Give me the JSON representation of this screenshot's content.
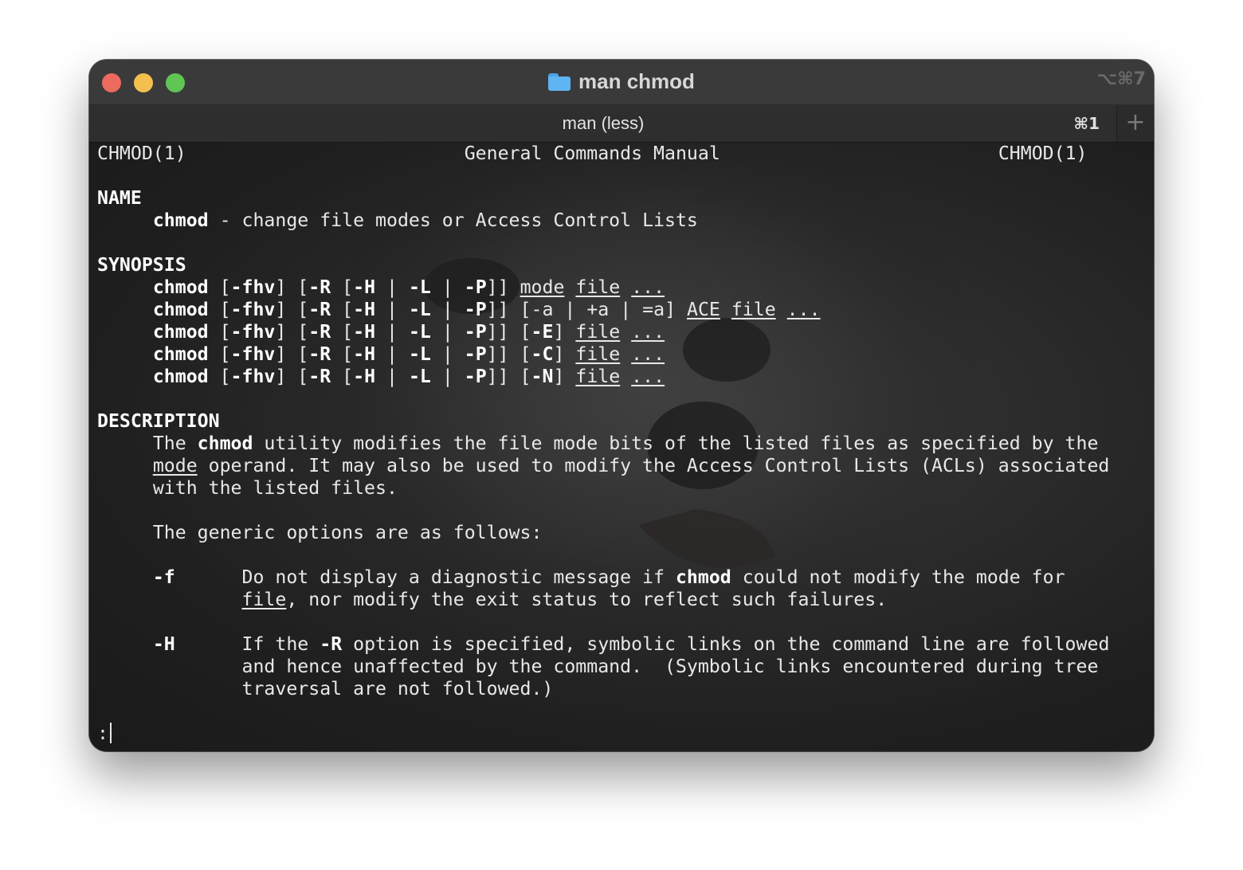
{
  "window": {
    "title": "man chmod",
    "title_shortcut": "⌥⌘7"
  },
  "tab": {
    "label": "man (less)",
    "shortcut": "⌘1",
    "new_tab_glyph": "+"
  },
  "man": {
    "header_left": "CHMOD(1)",
    "header_center": "General Commands Manual",
    "header_right": "CHMOD(1)",
    "name_heading": "NAME",
    "name_cmd": "chmod",
    "name_desc": " - change file modes or Access Control Lists",
    "synopsis_heading": "SYNOPSIS",
    "description_heading": "DESCRIPTION",
    "desc_p1_a": "The ",
    "desc_p1_cmd": "chmod",
    "desc_p1_b": " utility modifies the file mode bits of the listed files as specified by the",
    "desc_p1_mode": "mode",
    "desc_p1_c": " operand. It may also be used to modify the Access Control Lists (ACLs) associated",
    "desc_p1_d": "with the listed files.",
    "desc_p2": "The generic options are as follows:",
    "opt_f_flag": "-f",
    "opt_f_a": "Do not display a diagnostic message if ",
    "opt_f_cmd": "chmod",
    "opt_f_b": " could not modify the mode for",
    "opt_f_file": "file",
    "opt_f_c": ", nor modify the exit status to reflect such failures.",
    "opt_H_flag": "-H",
    "opt_H_a": "If the ",
    "opt_H_R": "-R",
    "opt_H_b": " option is specified, symbolic links on the command line are followed",
    "opt_H_c": "and hence unaffected by the command.  (Symbolic links encountered during tree",
    "opt_H_d": "traversal are not followed.)",
    "prompt": ":"
  },
  "synopsis": {
    "cmd": "chmod",
    "fhv": "-fhv",
    "R": "-R",
    "H": "-H",
    "L": "-L",
    "P": "-P",
    "mode": "mode",
    "file": "file",
    "dots": "...",
    "minus_a": "-a",
    "plus_a": "+a",
    "eq_a": "=a",
    "ace": "ACE",
    "E": "-E",
    "C": "-C",
    "N": "-N"
  }
}
